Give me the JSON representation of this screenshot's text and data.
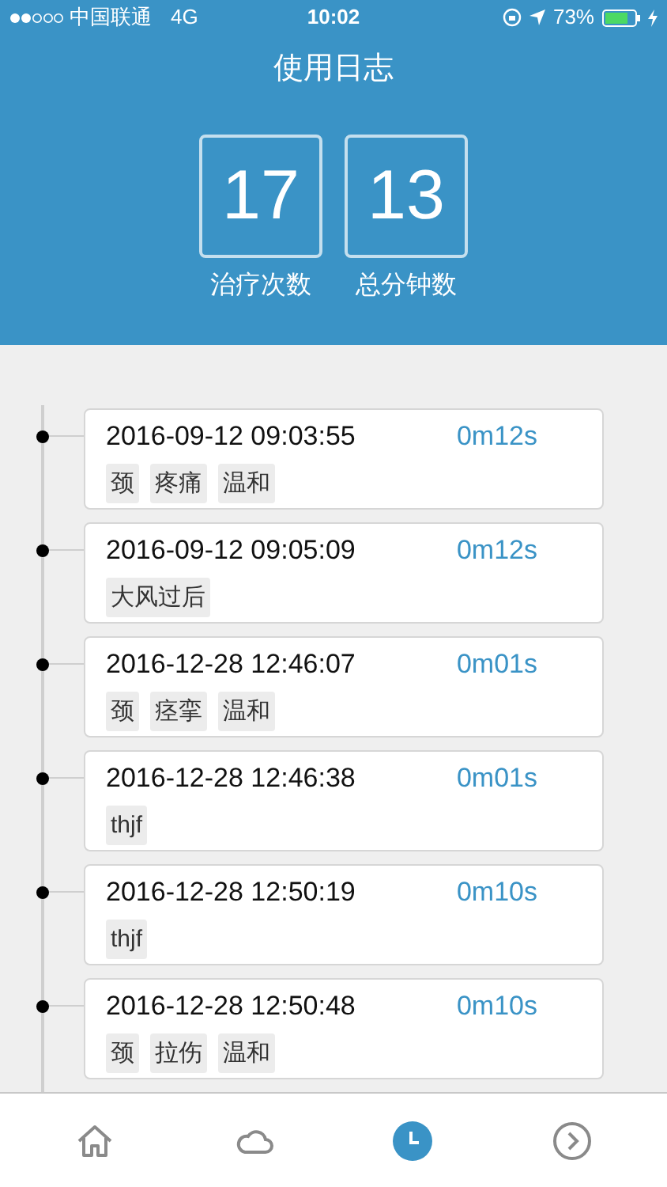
{
  "status_bar": {
    "carrier": "中国联通",
    "network": "4G",
    "time": "10:02",
    "battery": "73%"
  },
  "header": {
    "title": "使用日志",
    "stats": [
      {
        "value": "17",
        "label": "治疗次数"
      },
      {
        "value": "13",
        "label": "总分钟数"
      }
    ]
  },
  "log_entries": [
    {
      "datetime": "2016-09-12 09:03:55",
      "duration": "0m12s",
      "tags": [
        "颈",
        "疼痛",
        "温和"
      ]
    },
    {
      "datetime": "2016-09-12 09:05:09",
      "duration": "0m12s",
      "tags": [
        "大风过后"
      ]
    },
    {
      "datetime": "2016-12-28 12:46:07",
      "duration": "0m01s",
      "tags": [
        "颈",
        "痉挛",
        "温和"
      ]
    },
    {
      "datetime": "2016-12-28 12:46:38",
      "duration": "0m01s",
      "tags": [
        "thjf"
      ]
    },
    {
      "datetime": "2016-12-28 12:50:19",
      "duration": "0m10s",
      "tags": [
        "thjf"
      ]
    },
    {
      "datetime": "2016-12-28 12:50:48",
      "duration": "0m10s",
      "tags": [
        "颈",
        "拉伤",
        "温和"
      ]
    }
  ],
  "tab_bar": [
    {
      "kind": "home",
      "selected": false
    },
    {
      "kind": "cloud",
      "selected": false
    },
    {
      "kind": "clock",
      "selected": true
    },
    {
      "kind": "next",
      "selected": false
    }
  ]
}
